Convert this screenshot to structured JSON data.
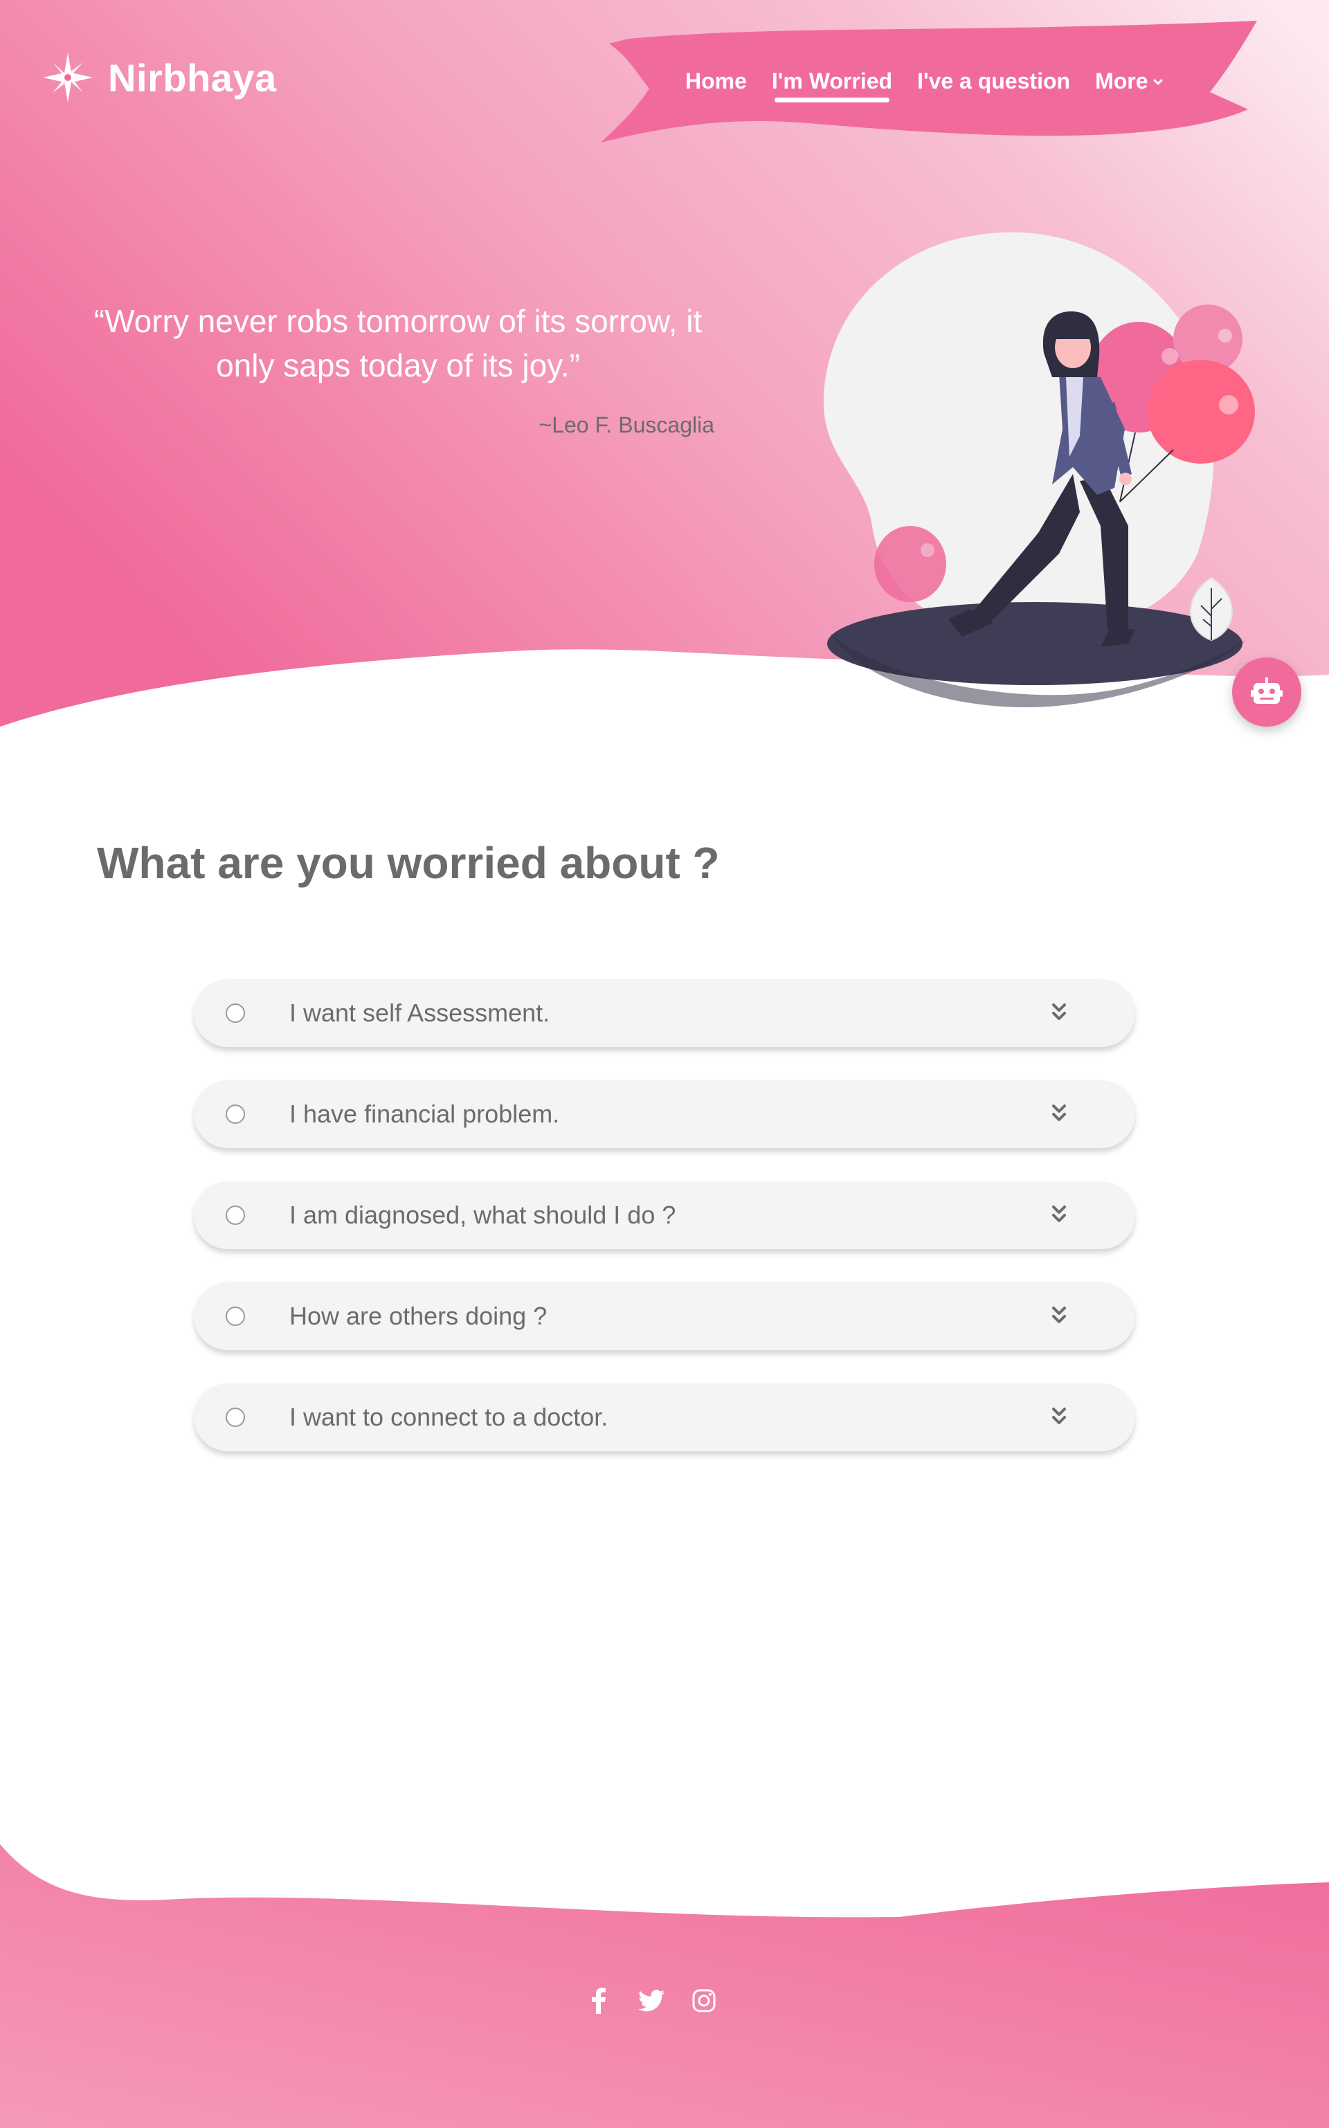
{
  "brand": {
    "name": "Nirbhaya"
  },
  "nav": {
    "items": [
      {
        "label": "Home"
      },
      {
        "label": "I'm Worried"
      },
      {
        "label": "I've a question"
      },
      {
        "label": "More"
      }
    ],
    "active": "I'm Worried"
  },
  "hero": {
    "quote": "“Worry never robs tomorrow of its sorrow, it only saps today of its joy.”",
    "author": "~Leo F. Buscaglia",
    "illustration": "woman-walking-with-balloons"
  },
  "chatbot": {
    "icon": "robot-icon"
  },
  "main": {
    "title": "What are you worried about ?",
    "options": [
      {
        "label": "I want self Assessment."
      },
      {
        "label": "I have financial problem."
      },
      {
        "label": "I am diagnosed, what should I do ?"
      },
      {
        "label": "How are others doing ?"
      },
      {
        "label": "I want to connect to a doctor."
      }
    ]
  },
  "footer": {
    "social": [
      {
        "icon": "facebook-icon"
      },
      {
        "icon": "twitter-icon"
      },
      {
        "icon": "instagram-icon"
      }
    ]
  },
  "colors": {
    "brand_pink": "#f06b9b",
    "light_pink": "#f7b3c8",
    "text_gray": "#6b6b6b",
    "card_bg": "#f4f4f4",
    "ground_dark": "#3f3d56"
  }
}
